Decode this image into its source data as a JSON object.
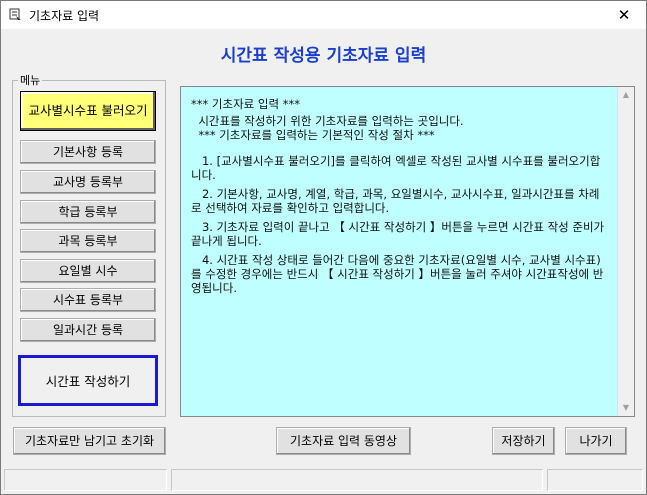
{
  "window": {
    "title": "기초자료 입력",
    "close_glyph": "✕"
  },
  "heading": "시간표 작성용 기초자료 입력",
  "menu": {
    "legend": "메뉴",
    "load_button": "교사별시수표 불러오기",
    "items": [
      {
        "label": "기본사항 등록"
      },
      {
        "label": "교사명 등록부"
      },
      {
        "label": "학급 등록부"
      },
      {
        "label": "과목 등록부"
      },
      {
        "label": "요일별 시수"
      },
      {
        "label": "시수표 등록부"
      },
      {
        "label": "일과시간 등록"
      }
    ],
    "make_button": "시간표 작성하기"
  },
  "instructions": {
    "lines": [
      "*** 기초자료 입력 ***",
      "  시간표를 작성하기 위한 기초자료를 입력하는 곳입니다.",
      "",
      "",
      "  *** 기초자료를 입력하는 기본적인 작성 절차 ***",
      "",
      "   1. [교사별시수표 불러오기]를 클릭하여 엑셀로 작성된 교사별 시수표를 불러오기합니다.",
      "",
      "   2. 기본사항, 교사명, 계열, 학급, 과목, 요일별시수, 교사시수표, 일과시간표를 차례로 선택하여 자료를 확인하고 입력합니다.",
      "",
      "   3. 기초자료 입력이 끝나고 【 시간표 작성하기 】버튼을 누르면 시간표 작성 준비가 끝나게 됩니다.",
      "",
      "   4. 시간표 작성 상태로 들어간 다음에 중요한 기초자료(요일별 시수, 교사별 시수표)를 수정한 경우에는 반드시 【 시간표 작성하기 】버튼을 눌러 주셔야 시간표작성에 반영됩니다."
    ]
  },
  "footer": {
    "reset_button": "기초자료만 남기고 초기화",
    "video_button": "기초자료 입력 동영상",
    "save_button": "저장하기",
    "exit_button": "나가기"
  }
}
